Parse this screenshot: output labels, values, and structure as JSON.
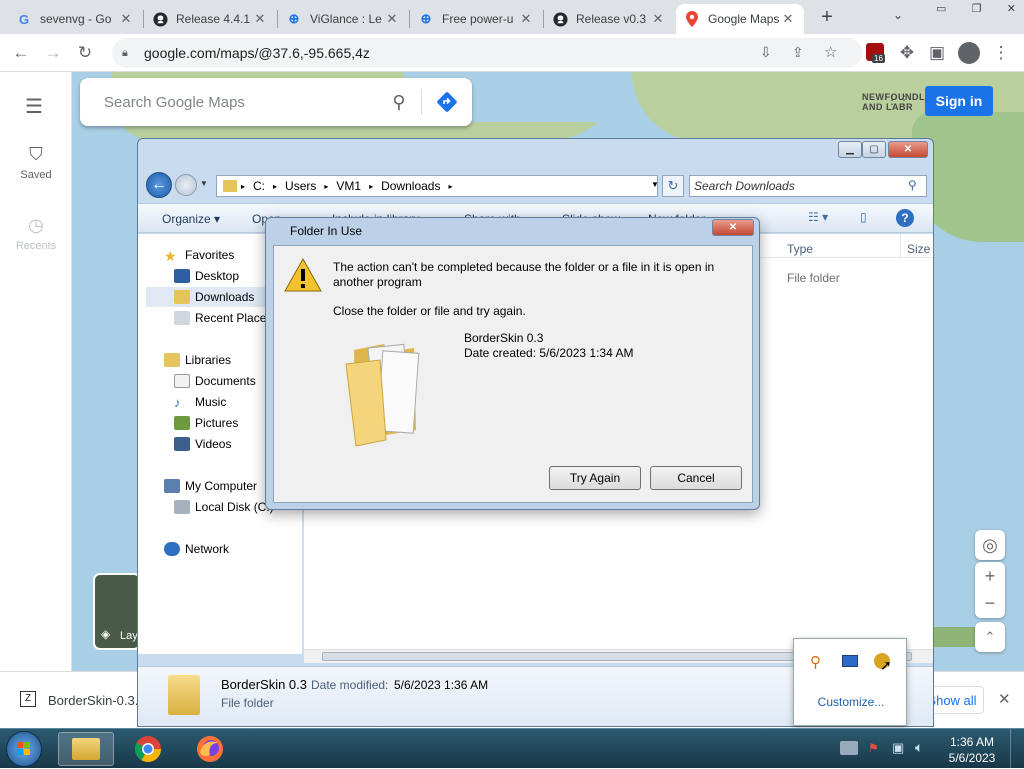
{
  "browser": {
    "tabs": [
      {
        "title": "sevenvg - Go",
        "icon": "G"
      },
      {
        "title": "Release 4.4.1",
        "icon": "github"
      },
      {
        "title": "ViGlance : Le",
        "icon": "globe"
      },
      {
        "title": "Free power-u",
        "icon": "globe"
      },
      {
        "title": "Release v0.3",
        "icon": "github"
      },
      {
        "title": "Google Maps",
        "icon": "maps-pin"
      }
    ],
    "url": "google.com/maps/@37.6,-95.665,4z",
    "extension_badge": "16"
  },
  "maps": {
    "search_placeholder": "Search Google Maps",
    "signin_label": "Sign in",
    "saved_label": "Saved",
    "recents_label": "Recents",
    "layers_label": "Layers",
    "map_label": "NEWFOUNDL AND LABR"
  },
  "explorer": {
    "breadcrumb": [
      "C:",
      "Users",
      "VM1",
      "Downloads"
    ],
    "search_placeholder": "Search Downloads",
    "organize_label": "Organize",
    "cmd_items": [
      "Open",
      "Include in library",
      "Share with",
      "Slide show",
      "New folder"
    ],
    "columns": {
      "type": "Type",
      "size": "Size"
    },
    "row_type": "File folder",
    "nav": {
      "favorites": "Favorites",
      "desktop": "Desktop",
      "downloads": "Downloads",
      "recent": "Recent Places",
      "libraries": "Libraries",
      "documents": "Documents",
      "music": "Music",
      "pictures": "Pictures",
      "videos": "Videos",
      "computer": "My Computer",
      "localdisk": "Local Disk (C:)",
      "network": "Network"
    },
    "details": {
      "name": "BorderSkin 0.3",
      "modified_label": "Date modified:",
      "modified_value": "5/6/2023 1:36 AM",
      "type": "File folder"
    }
  },
  "dialog": {
    "title": "Folder In Use",
    "message": "The action can't be completed because the folder or a file in it is open in another program",
    "hint": "Close the folder or file and try again.",
    "item_name": "BorderSkin 0.3",
    "item_date": "Date created: 5/6/2023 1:34 AM",
    "try_again": "Try Again",
    "cancel": "Cancel"
  },
  "downloads": {
    "file": "BorderSkin-0.3.z",
    "show_all": "Show all"
  },
  "tray_popup": {
    "customize": "Customize..."
  },
  "taskbar": {
    "time": "1:36 AM",
    "date": "5/6/2023"
  }
}
